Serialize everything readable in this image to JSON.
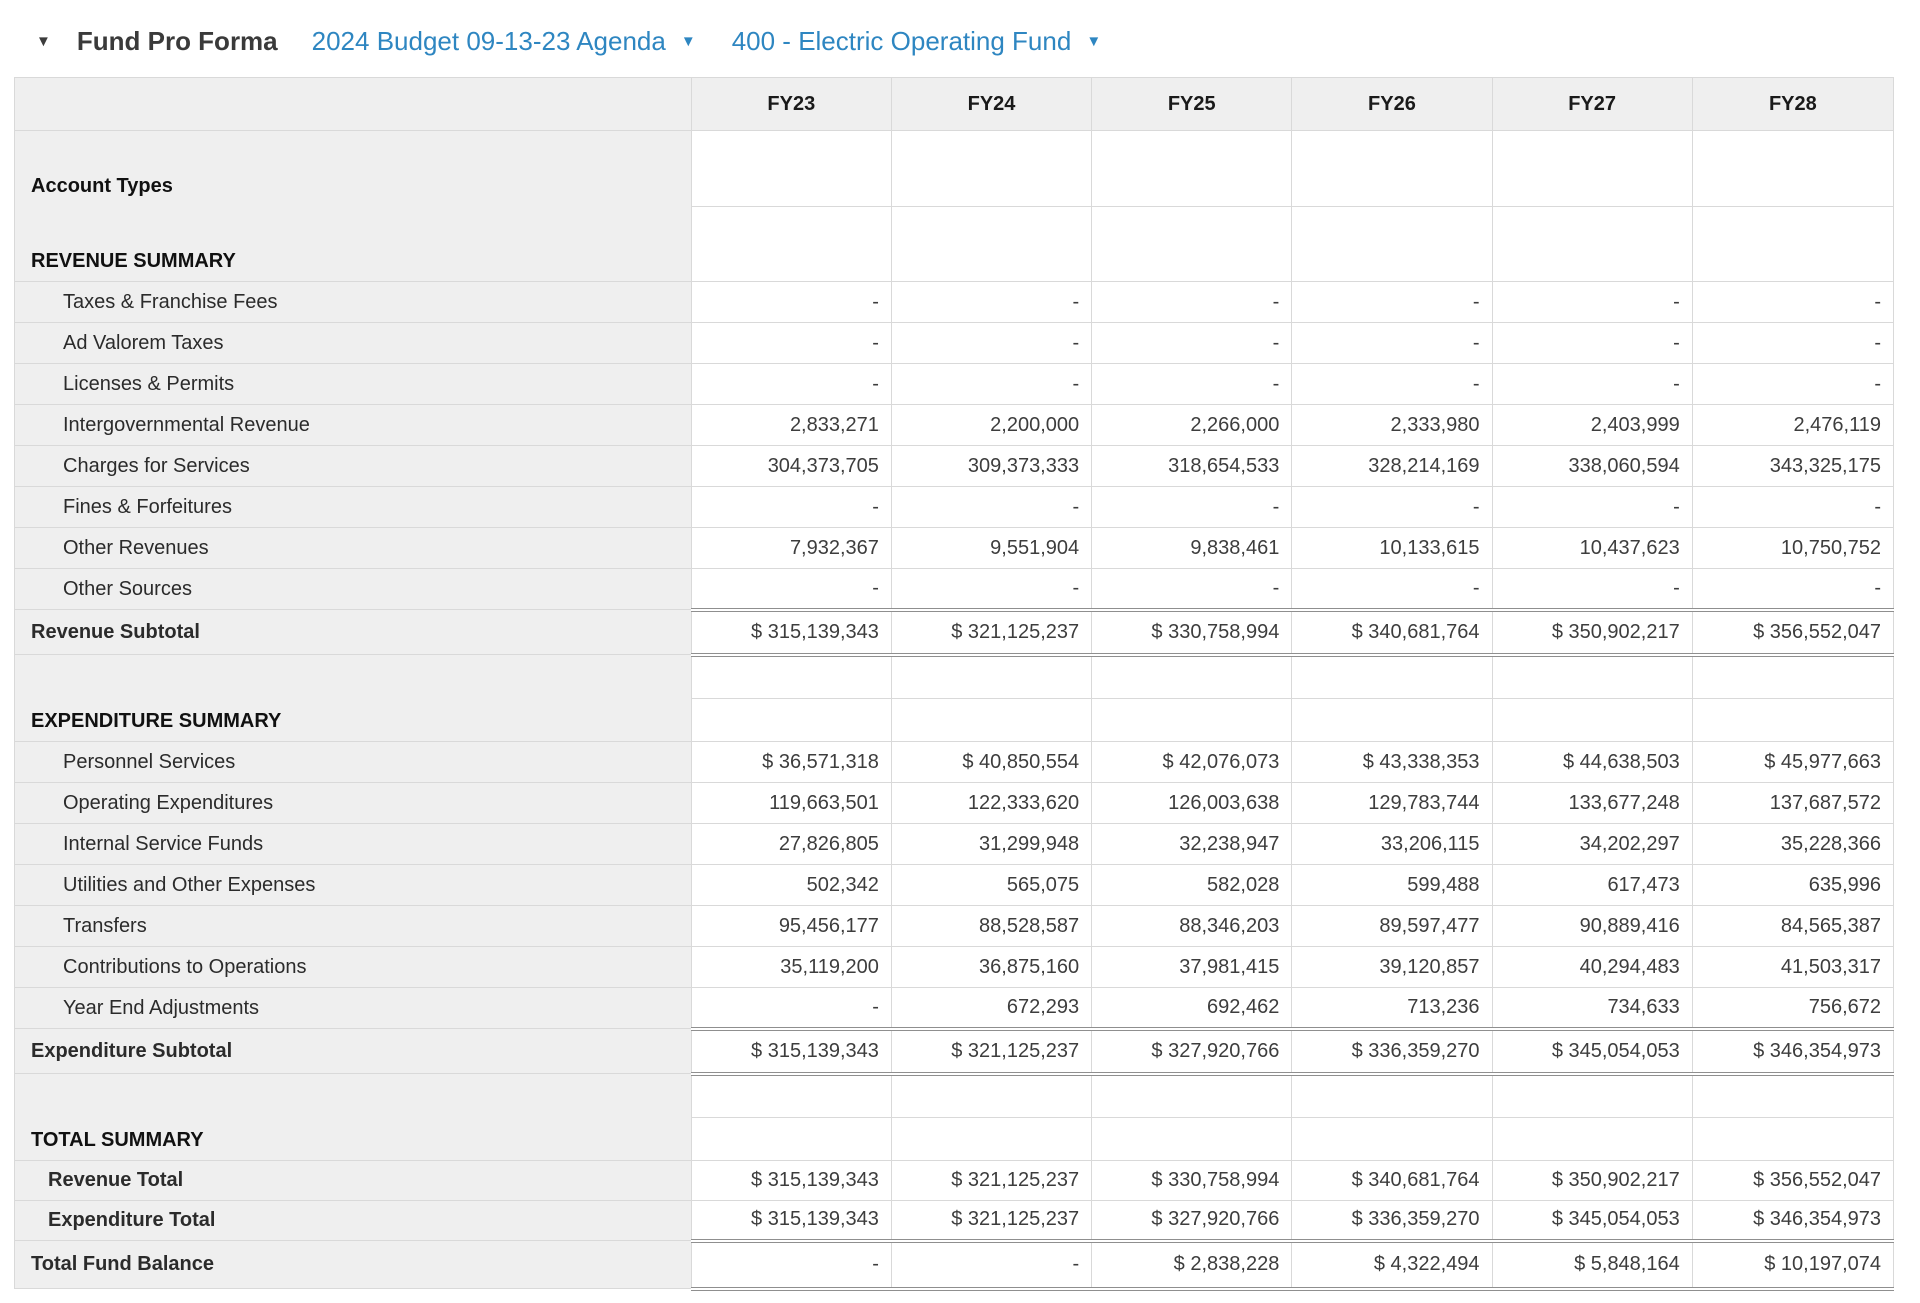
{
  "header": {
    "collapse_icon": "▼",
    "title": "Fund Pro Forma",
    "budget_dropdown": {
      "label": "2024 Budget 09-13-23 Agenda",
      "caret": "▼"
    },
    "fund_dropdown": {
      "label": "400 - Electric Operating Fund",
      "caret": "▼"
    },
    "accent_color": "#2e86c1"
  },
  "table": {
    "columns": [
      "FY23",
      "FY24",
      "FY25",
      "FY26",
      "FY27",
      "FY28"
    ],
    "rows": [
      {
        "kind": "band",
        "heights": [
          67,
          67
        ],
        "labels": [
          "Account Types",
          "REVENUE SUMMARY"
        ]
      },
      {
        "kind": "detail",
        "label": "Taxes & Franchise Fees",
        "values": [
          "-",
          "-",
          "-",
          "-",
          "-",
          "-"
        ]
      },
      {
        "kind": "detail",
        "label": "Ad Valorem Taxes",
        "values": [
          "-",
          "-",
          "-",
          "-",
          "-",
          "-"
        ]
      },
      {
        "kind": "detail",
        "label": "Licenses & Permits",
        "values": [
          "-",
          "-",
          "-",
          "-",
          "-",
          "-"
        ]
      },
      {
        "kind": "detail",
        "label": "Intergovernmental Revenue",
        "values": [
          "2,833,271",
          "2,200,000",
          "2,266,000",
          "2,333,980",
          "2,403,999",
          "2,476,119"
        ]
      },
      {
        "kind": "detail",
        "label": "Charges for Services",
        "values": [
          "304,373,705",
          "309,373,333",
          "318,654,533",
          "328,214,169",
          "338,060,594",
          "343,325,175"
        ]
      },
      {
        "kind": "detail",
        "label": "Fines & Forfeitures",
        "values": [
          "-",
          "-",
          "-",
          "-",
          "-",
          "-"
        ]
      },
      {
        "kind": "detail",
        "label": "Other Revenues",
        "values": [
          "7,932,367",
          "9,551,904",
          "9,838,461",
          "10,133,615",
          "10,437,623",
          "10,750,752"
        ]
      },
      {
        "kind": "detail",
        "label": "Other Sources",
        "values": [
          "-",
          "-",
          "-",
          "-",
          "-",
          "-"
        ]
      },
      {
        "kind": "subtotal",
        "label": "Revenue Subtotal",
        "values": [
          "$ 315,139,343",
          "$ 321,125,237",
          "$ 330,758,994",
          "$ 340,681,764",
          "$ 350,902,217",
          "$ 356,552,047"
        ]
      },
      {
        "kind": "band",
        "heights": [
          35,
          35
        ],
        "labels": [
          "",
          "EXPENDITURE SUMMARY"
        ]
      },
      {
        "kind": "detail",
        "label": "Personnel Services",
        "values": [
          "$ 36,571,318",
          "$ 40,850,554",
          "$ 42,076,073",
          "$ 43,338,353",
          "$ 44,638,503",
          "$ 45,977,663"
        ]
      },
      {
        "kind": "detail",
        "label": "Operating Expenditures",
        "values": [
          "119,663,501",
          "122,333,620",
          "126,003,638",
          "129,783,744",
          "133,677,248",
          "137,687,572"
        ]
      },
      {
        "kind": "detail",
        "label": "Internal Service Funds",
        "values": [
          "27,826,805",
          "31,299,948",
          "32,238,947",
          "33,206,115",
          "34,202,297",
          "35,228,366"
        ]
      },
      {
        "kind": "detail",
        "label": "Utilities and Other Expenses",
        "values": [
          "502,342",
          "565,075",
          "582,028",
          "599,488",
          "617,473",
          "635,996"
        ]
      },
      {
        "kind": "detail",
        "label": "Transfers",
        "values": [
          "95,456,177",
          "88,528,587",
          "88,346,203",
          "89,597,477",
          "90,889,416",
          "84,565,387"
        ]
      },
      {
        "kind": "detail",
        "label": "Contributions to Operations",
        "values": [
          "35,119,200",
          "36,875,160",
          "37,981,415",
          "39,120,857",
          "40,294,483",
          "41,503,317"
        ]
      },
      {
        "kind": "detail",
        "label": "Year End Adjustments",
        "values": [
          "-",
          "672,293",
          "692,462",
          "713,236",
          "734,633",
          "756,672"
        ]
      },
      {
        "kind": "subtotal",
        "label": "Expenditure Subtotal",
        "values": [
          "$ 315,139,343",
          "$ 321,125,237",
          "$ 327,920,766",
          "$ 336,359,270",
          "$ 345,054,053",
          "$ 346,354,973"
        ]
      },
      {
        "kind": "band",
        "heights": [
          35,
          35
        ],
        "labels": [
          "",
          "TOTAL SUMMARY"
        ]
      },
      {
        "kind": "total",
        "label": "Revenue Total",
        "values": [
          "$ 315,139,343",
          "$ 321,125,237",
          "$ 330,758,994",
          "$ 340,681,764",
          "$ 350,902,217",
          "$ 356,552,047"
        ]
      },
      {
        "kind": "total-last",
        "label": "Expenditure Total",
        "values": [
          "$ 315,139,343",
          "$ 321,125,237",
          "$ 327,920,766",
          "$ 336,359,270",
          "$ 345,054,053",
          "$ 346,354,973"
        ]
      },
      {
        "kind": "grand",
        "label": "Total Fund Balance",
        "values": [
          "-",
          "-",
          "$ 2,838,228",
          "$ 4,322,494",
          "$ 5,848,164",
          "$ 10,197,074"
        ]
      }
    ]
  }
}
